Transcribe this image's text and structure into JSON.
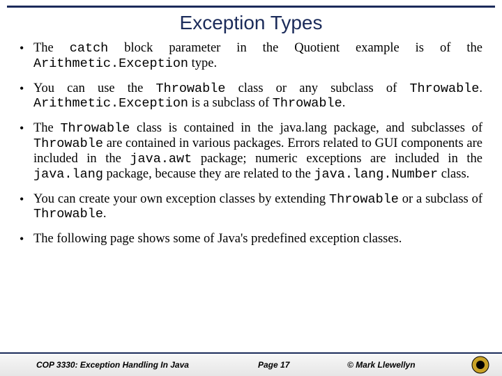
{
  "title": "Exception Types",
  "bullets": {
    "b1": {
      "t1": "The ",
      "code1": "catch",
      "t2": " block parameter in the Quotient example is of the ",
      "code2": "Arithmetic.Exception",
      "t3": " type."
    },
    "b2": {
      "t1": "You can use the ",
      "code1": "Throwable",
      "t2": " class or any subclass of ",
      "code2": "Throwable",
      "t3": ". ",
      "code3": "Arithmetic.Exception",
      "t4": " is a subclass of ",
      "code4": "Throwable",
      "t5": "."
    },
    "b3": {
      "t1": "The ",
      "code1": "Throwable",
      "t2": " class is contained in the java.lang package, and subclasses of ",
      "code2": "Throwable",
      "t3": " are contained in various packages. Errors related to GUI components are included in the ",
      "code3": "java.awt",
      "t4": " package; numeric exceptions are included in the ",
      "code4": "java.lang",
      "t5": " package, because they are related to the ",
      "code5": "java.lang.Number",
      "t6": " class."
    },
    "b4": {
      "t1": "You can create your own exception classes by extending ",
      "code1": "Throwable",
      "t2": " or a subclass of ",
      "code2": "Throwable",
      "t3": "."
    },
    "b5": {
      "t1": "The following page shows some of Java's predefined exception classes."
    }
  },
  "footer": {
    "course": "COP 3330: Exception Handling In Java",
    "page": "Page 17",
    "author": "© Mark Llewellyn"
  }
}
